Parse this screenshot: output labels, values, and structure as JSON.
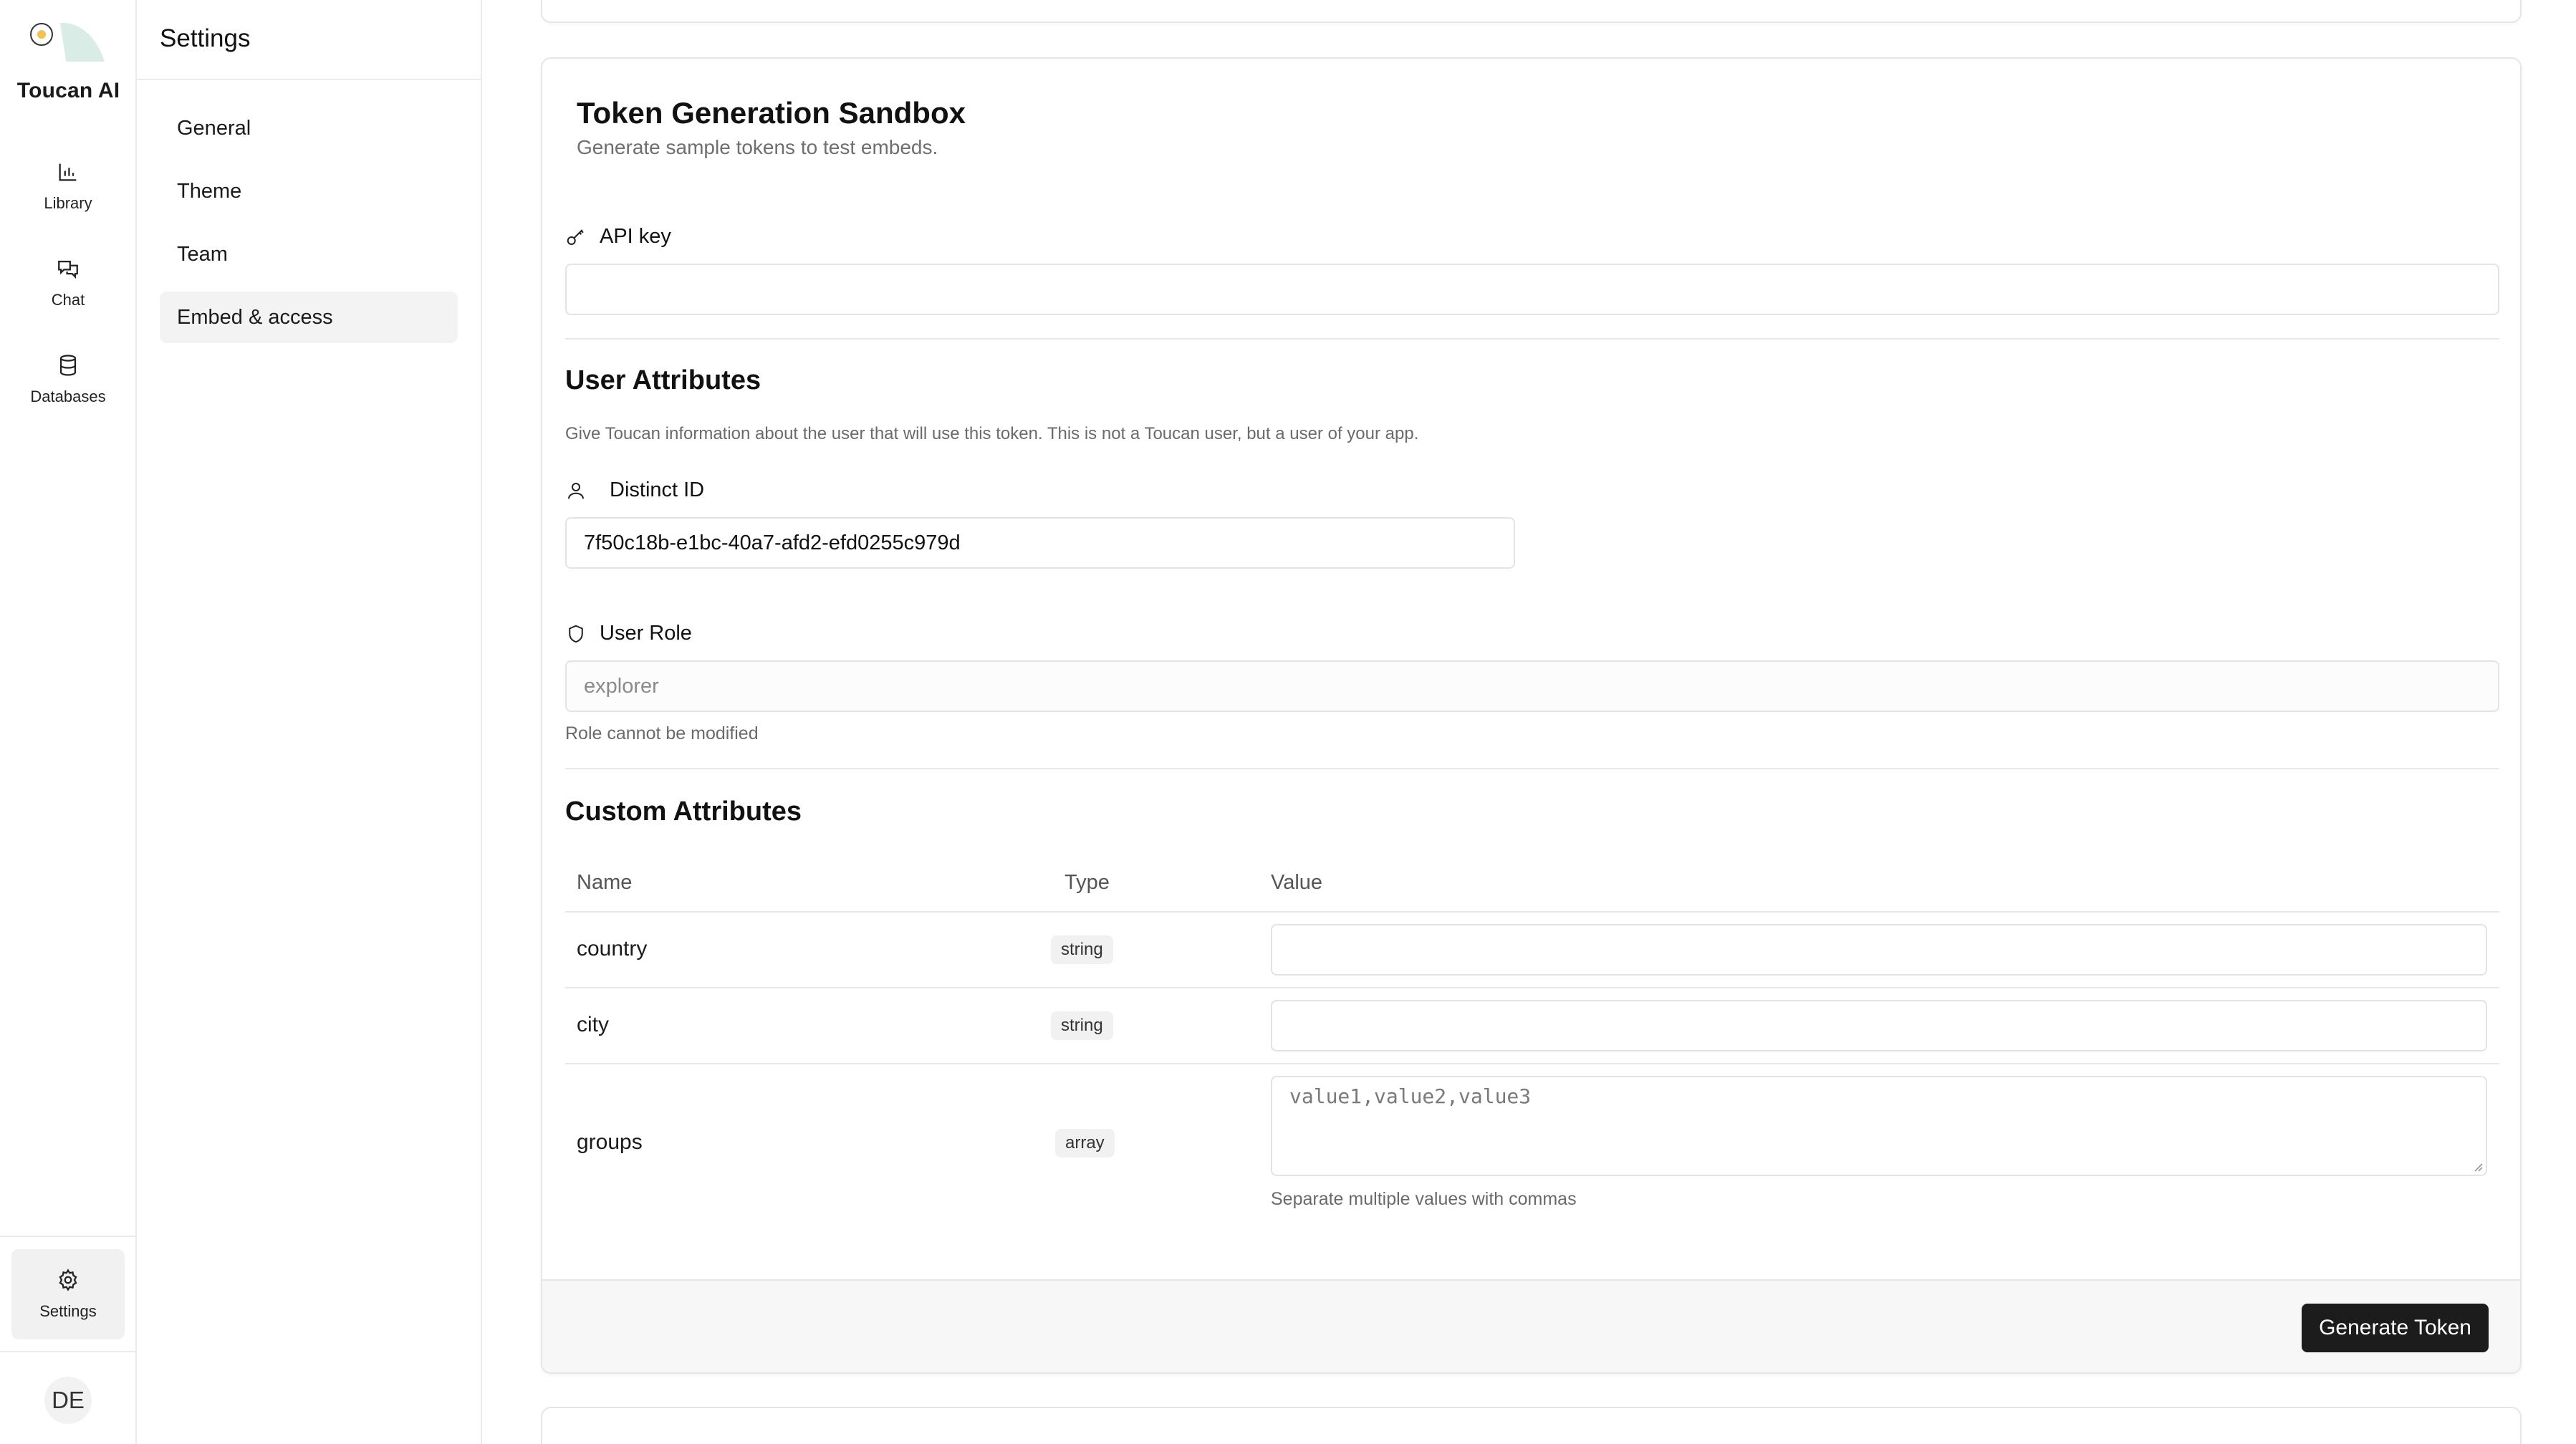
{
  "app": {
    "name": "Toucan AI",
    "accent_color": "#f2c14e",
    "logo_icon": "toucan-logo"
  },
  "rail": {
    "items": [
      {
        "label": "Library",
        "icon": "bar-chart-icon"
      },
      {
        "label": "Chat",
        "icon": "chat-bubbles-icon"
      },
      {
        "label": "Databases",
        "icon": "database-icon"
      }
    ],
    "settings": {
      "label": "Settings",
      "icon": "gear-icon"
    },
    "avatar_initials": "DE"
  },
  "settings_nav": {
    "title": "Settings",
    "items": [
      {
        "label": "General"
      },
      {
        "label": "Theme"
      },
      {
        "label": "Team"
      },
      {
        "label": "Embed & access",
        "active": true
      }
    ]
  },
  "sandbox": {
    "title": "Token Generation Sandbox",
    "subtitle": "Generate sample tokens to test embeds.",
    "api_key": {
      "label": "API key",
      "icon": "key-icon",
      "value": ""
    },
    "user_attributes": {
      "title": "User Attributes",
      "description": "Give Toucan information about the user that will use this token. This is not a Toucan user, but a user of your app.",
      "distinct_id": {
        "label": "Distinct ID",
        "icon": "user-icon",
        "value": "7f50c18b-e1bc-40a7-afd2-efd0255c979d"
      },
      "user_role": {
        "label": "User Role",
        "icon": "shield-icon",
        "value": "explorer",
        "help": "Role cannot be modified"
      }
    },
    "custom_attributes": {
      "title": "Custom Attributes",
      "columns": {
        "name": "Name",
        "type": "Type",
        "value": "Value"
      },
      "rows": [
        {
          "name": "country",
          "type": "string",
          "value": ""
        },
        {
          "name": "city",
          "type": "string",
          "value": ""
        },
        {
          "name": "groups",
          "type": "array",
          "placeholder": "value1,value2,value3",
          "help": "Separate multiple values with commas"
        }
      ]
    },
    "generate_button": "Generate Token"
  }
}
